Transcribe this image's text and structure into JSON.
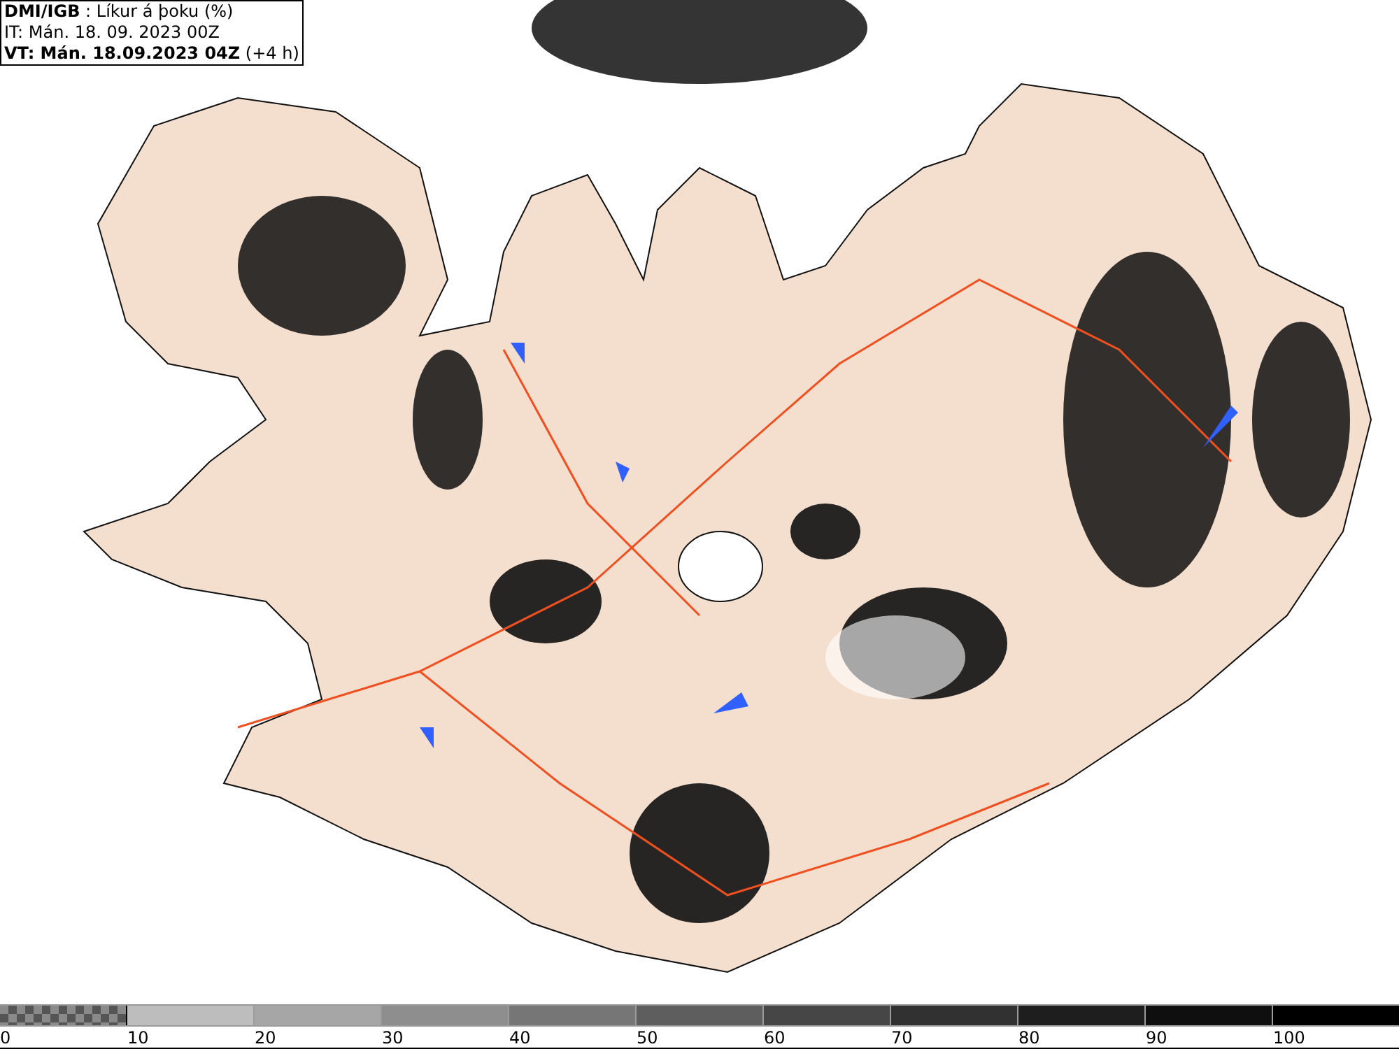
{
  "info_box": {
    "lines": [
      "**DMI/IGB** : Líkur á þoku (%)",
      "IT: Mán. 18. 09. 2023 00Z",
      "**VT: Mán. 18.09.2023 04Z** (+4 h)"
    ]
  },
  "legend": {
    "bins": [
      {
        "kind": "checker",
        "color": "#8a8a8a"
      },
      {
        "kind": "solid",
        "color": "#bdbdbd"
      },
      {
        "kind": "solid",
        "color": "#a6a6a6"
      },
      {
        "kind": "solid",
        "color": "#8e8e8e"
      },
      {
        "kind": "solid",
        "color": "#767676"
      },
      {
        "kind": "solid",
        "color": "#5e5e5e"
      },
      {
        "kind": "solid",
        "color": "#464646"
      },
      {
        "kind": "solid",
        "color": "#313131"
      },
      {
        "kind": "solid",
        "color": "#1e1e1e"
      },
      {
        "kind": "solid",
        "color": "#0f0f0f"
      },
      {
        "kind": "solid",
        "color": "#000000"
      }
    ],
    "labels": [
      "0",
      "10",
      "20",
      "30",
      "40",
      "50",
      "60",
      "70",
      "80",
      "90",
      "100"
    ]
  }
}
